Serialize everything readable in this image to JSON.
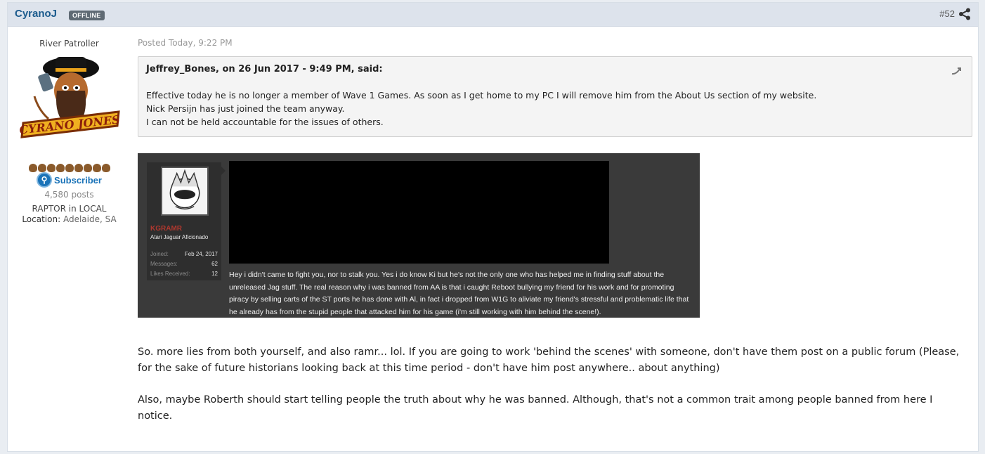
{
  "post": {
    "author": "CyranoJ",
    "status_badge": "OFFLINE",
    "post_number": "#52",
    "posted": "Posted Today, 9:22 PM",
    "body": [
      "So. more lies from both yourself, and also ramr... lol. If you are going to work 'behind the scenes' with someone, don't have them post on a public forum (Please, for the sake of future historians looking back at this time period - don't have him post anywhere.. about anything)",
      "Also, maybe Roberth should start telling people the truth about why he was banned. Although, that's not a common trait among people banned from here I notice."
    ]
  },
  "sidebar": {
    "member_title": "River Patroller",
    "avatar_text": "CYRANO JONES",
    "subscriber_label": "Subscriber",
    "post_count": "4,580 posts",
    "custom_field": "RAPTOR in LOCAL",
    "location_label": "Location:",
    "location_value": "Adelaide, SA"
  },
  "quote": {
    "citation": "Jeffrey_Bones, on 26 Jun 2017 - 9:49 PM, said:",
    "lines": [
      "Effective today he is no longer a member of Wave 1 Games. As soon as I get home to my PC I will remove him from the About Us section of my website.",
      "Nick Persijn has just joined the team anyway.",
      "I can not be held accountable for the issues of others."
    ]
  },
  "embed": {
    "username": "KGRAMR",
    "user_title": "Atari Jaguar Aficionado",
    "stats": [
      {
        "label": "Joined:",
        "value": "Feb 24, 2017"
      },
      {
        "label": "Messages:",
        "value": "62"
      },
      {
        "label": "Likes Received:",
        "value": "12"
      }
    ],
    "message": "Hey i didn't came to fight you, nor to stalk you. Yes i do know Ki but he's not the only one who has helped me in finding stuff about the unreleased Jag stuff. The real reason why i was banned from AA is that i caught Reboot bullying my friend for his work and for promoting piracy by selling carts of the ST ports he has done with Al, in fact i dropped from W1G to aliviate my friend's stressful and problematic life that he already has from the stupid people that attacked him for his game (i'm still working with him behind the scene!)."
  },
  "icons": {
    "share": "share-icon",
    "quote_arrow": "quote-arrow-icon",
    "subscriber": "subscriber-icon"
  },
  "colors": {
    "author": "#1b5b8d",
    "header_bg": "#dde3ec",
    "badge_bg": "#5f6a74",
    "embed_bg": "#3a3a3a",
    "embed_username": "#b0382e"
  }
}
